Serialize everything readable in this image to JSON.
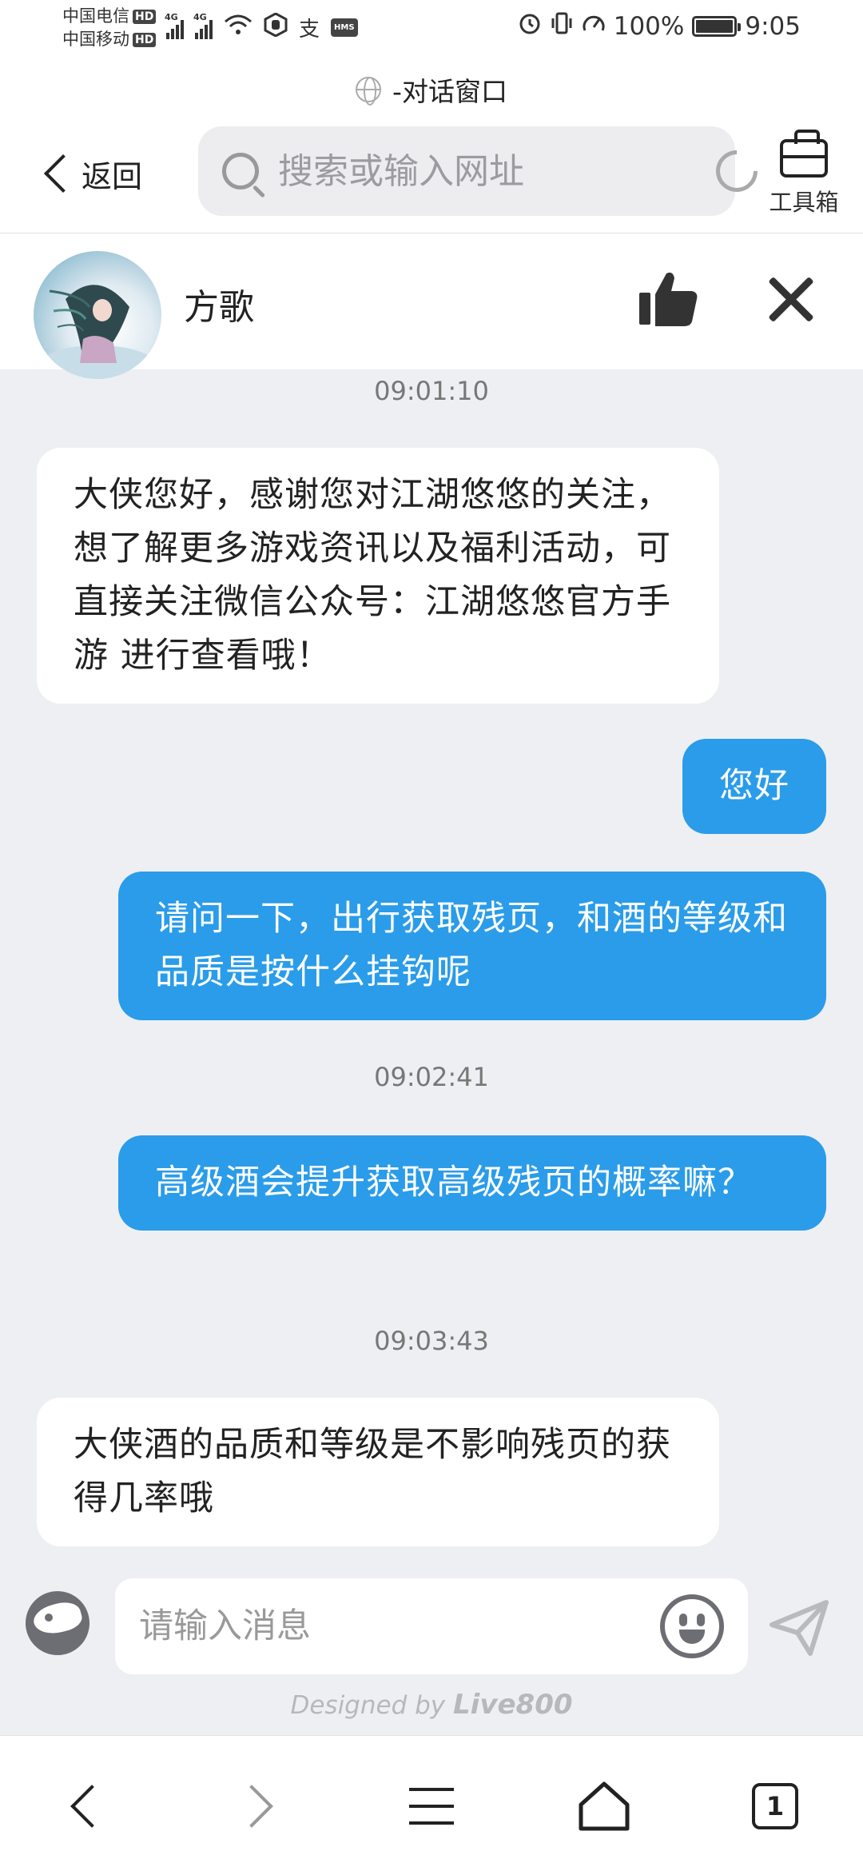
{
  "status_bar": {
    "carrier1": "中国电信",
    "carrier2": "中国移动",
    "hd": "HD",
    "net1": "4G",
    "net2": "4G",
    "hms": "HMS",
    "pay": "支",
    "battery_text": "100%",
    "time": "9:05"
  },
  "page": {
    "title": "-对话窗口"
  },
  "browser": {
    "back_label": "返回",
    "search_placeholder": "搜索或输入网址",
    "toolbox_label": "工具箱"
  },
  "chat": {
    "agent_name": "方歌",
    "messages": [
      {
        "type": "time",
        "text": "09:01:10"
      },
      {
        "type": "agent",
        "text": "大侠您好，感谢您对江湖悠悠的关注，想了解更多游戏资讯以及福利活动，可直接关注微信公众号：江湖悠悠官方手游 进行查看哦！"
      },
      {
        "type": "user",
        "text": "您好"
      },
      {
        "type": "user",
        "text": "请问一下，出行获取残页，和酒的等级和品质是按什么挂钩呢"
      },
      {
        "type": "time",
        "text": "09:02:41"
      },
      {
        "type": "user",
        "text": "高级酒会提升获取高级残页的概率嘛？"
      },
      {
        "type": "time",
        "text": "09:03:43"
      },
      {
        "type": "agent",
        "text": "大侠酒的品质和等级是不影响残页的获得几率哦"
      }
    ],
    "input_placeholder": "请输入消息",
    "designed_by_prefix": "Designed by",
    "designed_by_brand": "Live800"
  },
  "bottom_nav": {
    "tabs_count": "1"
  },
  "colors": {
    "user_bubble": "#2a9ce9",
    "background": "#eeeff2"
  }
}
